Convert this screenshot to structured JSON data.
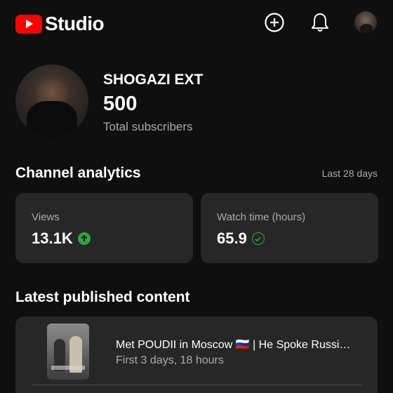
{
  "header": {
    "logo_text": "Studio",
    "icons": [
      "create-icon",
      "notifications-bell-icon"
    ],
    "accent": "#ff0000"
  },
  "channel": {
    "name": "SHOGAZI EXT",
    "subscriber_count": "500",
    "subscriber_label": "Total subscribers"
  },
  "analytics": {
    "title": "Channel analytics",
    "range": "Last 28 days",
    "cards": [
      {
        "label": "Views",
        "value": "13.1K",
        "indicator": "arrow-up-icon"
      },
      {
        "label": "Watch time (hours)",
        "value": "65.9",
        "indicator": "check-circle-icon"
      }
    ],
    "indicator_color": "#2ba640"
  },
  "latest": {
    "title": "Latest published content",
    "video": {
      "title": "Met POUDII in Moscow 🇷🇺 | He Spoke Russi…",
      "stat": "First 3 days, 18 hours"
    }
  }
}
